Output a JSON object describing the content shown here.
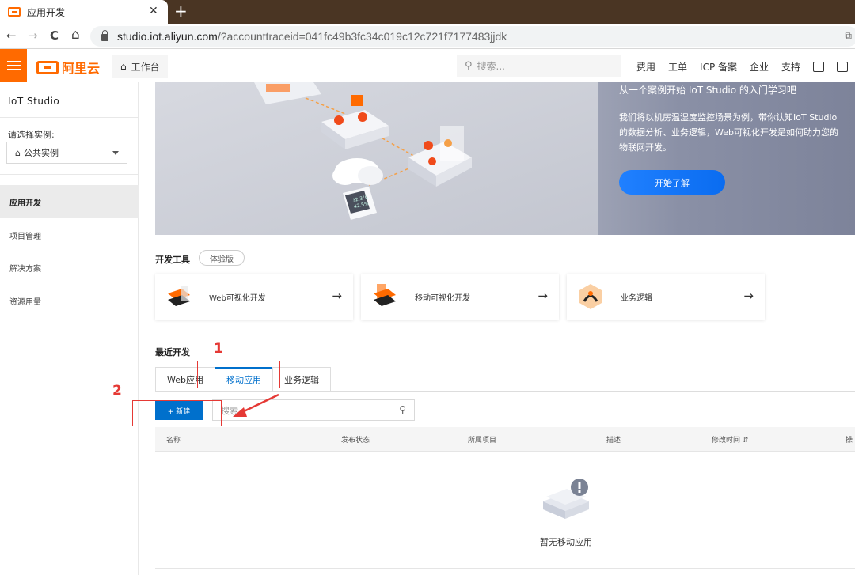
{
  "browser": {
    "tab_title": "应用开发",
    "close_glyph": "✕",
    "new_tab_glyph": "+",
    "nav_back": "←",
    "nav_forward": "→",
    "nav_reload": "C",
    "nav_home": "⌂",
    "url_main": "studio.iot.aliyun.com",
    "url_rest": "/?accounttraceid=041fc49b3fc34c019c12c721f7177483jjdk"
  },
  "header": {
    "brand": "阿里云",
    "workbench": "工作台",
    "search_placeholder": "搜索...",
    "links": [
      "费用",
      "工单",
      "ICP 备案",
      "企业",
      "支持"
    ]
  },
  "sidebar": {
    "title": "IoT Studio",
    "instance_label": "请选择实例:",
    "instance_value": "公共实例",
    "items": [
      {
        "label": "应用开发",
        "active": true
      },
      {
        "label": "项目管理",
        "active": false
      },
      {
        "label": "解决方案",
        "active": false
      },
      {
        "label": "资源用量",
        "active": false
      }
    ]
  },
  "banner": {
    "heading": "从一个案例开始 IoT Studio 的入门学习吧",
    "desc_line1": "我们将以机房温湿度监控场景为例，带你认知IoT Studio",
    "desc_line2": "的数据分析、业务逻辑，Web可视化开发是如何助力您的",
    "desc_line3": "物联网开发。",
    "button": "开始了解",
    "sensor_line1": "32.3°C",
    "sensor_line2": "42.5%"
  },
  "dev_tools": {
    "title": "开发工具",
    "badge": "体验版",
    "cards": [
      {
        "label": "Web可视化开发",
        "arrow": "→"
      },
      {
        "label": "移动可视化开发",
        "arrow": "→"
      },
      {
        "label": "业务逻辑",
        "arrow": "→"
      }
    ]
  },
  "recent": {
    "title": "最近开发",
    "tabs": [
      {
        "label": "Web应用",
        "active": false
      },
      {
        "label": "移动应用",
        "active": true
      },
      {
        "label": "业务逻辑",
        "active": false
      }
    ],
    "new_button": "+ 新建",
    "search_placeholder": "搜索",
    "columns": [
      "名称",
      "发布状态",
      "所属项目",
      "描述",
      "修改时间",
      "操"
    ],
    "empty_text": "暂无移动应用"
  },
  "annotations": {
    "one": "1",
    "two": "2"
  },
  "colors": {
    "brand_orange": "#ff6a00",
    "primary_blue": "#0070cc",
    "annotation_red": "#e53935"
  }
}
